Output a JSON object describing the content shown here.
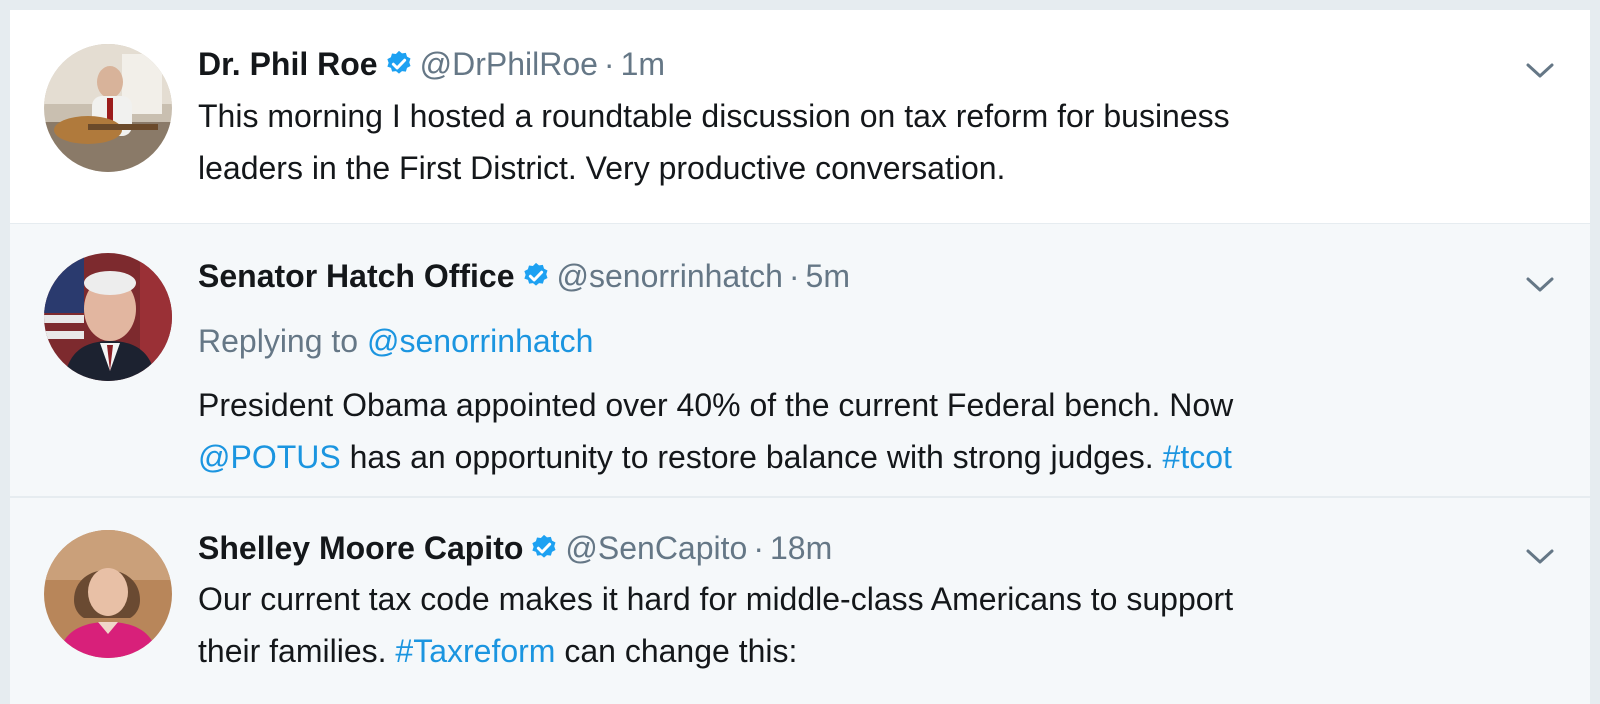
{
  "tweets": [
    {
      "name": "Dr. Phil Roe",
      "handle": "@DrPhilRoe",
      "separator": "·",
      "time": "1m",
      "text_lines": [
        "This morning I hosted a roundtable discussion on tax reform for business",
        "leaders in the First District. Very productive conversation."
      ]
    },
    {
      "name": "Senator Hatch Office",
      "handle": "@senorrinhatch",
      "separator": "·",
      "time": "5m",
      "replying_prefix": "Replying to",
      "replying_to": "@senorrinhatch",
      "text_line1": "President Obama appointed over 40% of the current Federal bench. Now",
      "mention": "@POTUS",
      "text_line2_mid": "has an opportunity to restore balance with strong judges.",
      "hashtag": "#tcot"
    },
    {
      "name": "Shelley Moore Capito",
      "handle": "@SenCapito",
      "separator": "·",
      "time": "18m",
      "text_line1": "Our current tax code makes it hard for middle-class Americans to support",
      "text_line2_pre": "their families.",
      "hashtag": "#Taxreform",
      "text_line2_post": "can change this:"
    }
  ],
  "icons": {
    "verified": "verified-badge-icon",
    "caret": "chevron-down-icon"
  },
  "colors": {
    "link": "#1b95e0",
    "verified": "#1da1f2",
    "muted": "#657786",
    "text": "#14171a",
    "alt_background": "#f5f8fa"
  }
}
